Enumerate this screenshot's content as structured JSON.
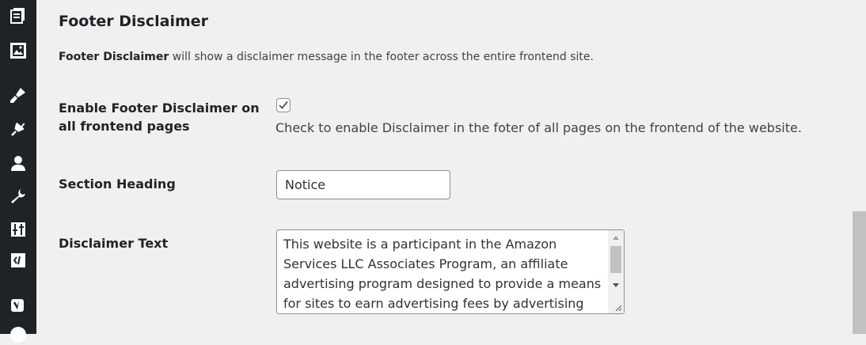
{
  "sidebar": {
    "icons": [
      "pages-icon",
      "media-icon",
      "appearance-icon",
      "plugins-icon",
      "users-icon",
      "tools-icon",
      "settings-icon",
      "code-icon",
      "yoast-icon",
      "profile-icon"
    ]
  },
  "section": {
    "title": "Footer Disclaimer",
    "description_strong": "Footer Disclaimer",
    "description_rest": " will show a disclaimer message in the footer across the entire frontend site."
  },
  "enable": {
    "label": "Enable Footer Disclaimer on all frontend pages",
    "checked": true,
    "help": "Check to enable Disclaimer in the foter of all pages on the frontend of the website."
  },
  "heading": {
    "label": "Section Heading",
    "value": "Notice"
  },
  "disclaimer": {
    "label": "Disclaimer Text",
    "value": "This website is a participant in the Amazon Services LLC Associates Program, an affiliate advertising program designed to provide a means for sites to earn advertising fees by advertising and linking to"
  },
  "colors": {
    "sidebar_bg": "#1d2327",
    "page_bg": "#f0f0f1",
    "text": "#1d2327"
  }
}
